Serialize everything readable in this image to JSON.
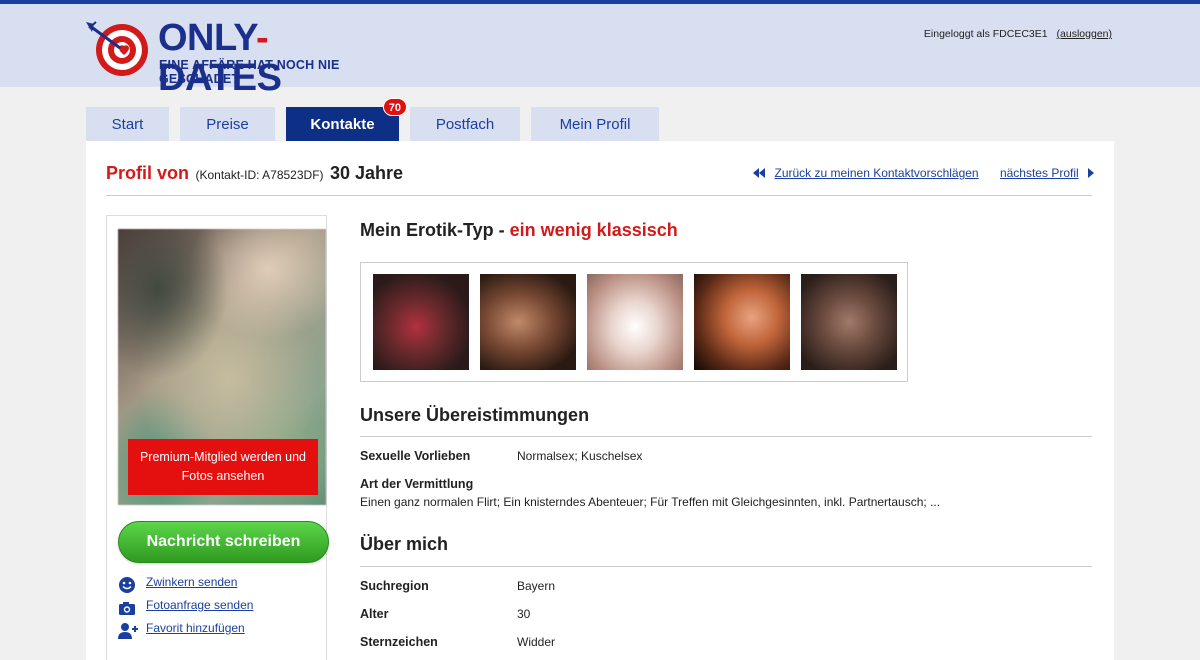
{
  "brand": {
    "name_part1": "ONLY",
    "name_dash": "-",
    "name_part2": "DATES",
    "tagline": "EINE AFFÄRE HAT NOCH NIE GESCHADET",
    "colors": {
      "blue": "#1b2f8c",
      "red": "#d21a1a",
      "header_bg": "#d8dff0"
    }
  },
  "header": {
    "login_text": "Eingeloggt als FDCEC3E1",
    "logout_label": "(ausloggen)"
  },
  "tabs": [
    {
      "label": "Start",
      "active": false
    },
    {
      "label": "Preise",
      "active": false
    },
    {
      "label": "Kontakte",
      "active": true,
      "badge": "70"
    },
    {
      "label": "Postfach",
      "active": false
    },
    {
      "label": "Mein Profil",
      "active": false
    }
  ],
  "profile": {
    "title_prefix": "Profil von",
    "contact_id": "(Kontakt-ID: A78523DF)",
    "age": "30 Jahre",
    "back_link": "Zurück zu meinen Kontaktvorschlägen",
    "next_link": "nächstes Profil"
  },
  "sidebar": {
    "premium_text": "Premium-Mitglied werden und Fotos ansehen",
    "message_button": "Nachricht schreiben",
    "actions": [
      {
        "icon": "smiley-icon",
        "label": "Zwinkern senden"
      },
      {
        "icon": "camera-icon",
        "label": "Fotoanfrage senden"
      },
      {
        "icon": "add-user-icon",
        "label": "Favorit hinzufügen"
      }
    ]
  },
  "erotik": {
    "heading": "Mein Erotik-Typ - ",
    "type": "ein wenig klassisch",
    "photo_count": 5
  },
  "matches": {
    "heading": "Unsere Übereistimmungen",
    "rows": [
      {
        "label": "Sexuelle Vorlieben",
        "value": "Normalsex; Kuschelsex"
      },
      {
        "label": "Art der Vermittlung",
        "value": "Einen ganz normalen Flirt; Ein knisterndes Abenteuer; Für Treffen mit Gleichgesinnten, inkl. Partnertausch; ..."
      }
    ]
  },
  "about": {
    "heading": "Über mich",
    "rows": [
      {
        "label": "Suchregion",
        "value": "Bayern"
      },
      {
        "label": "Alter",
        "value": "30"
      },
      {
        "label": "Sternzeichen",
        "value": "Widder"
      }
    ]
  }
}
